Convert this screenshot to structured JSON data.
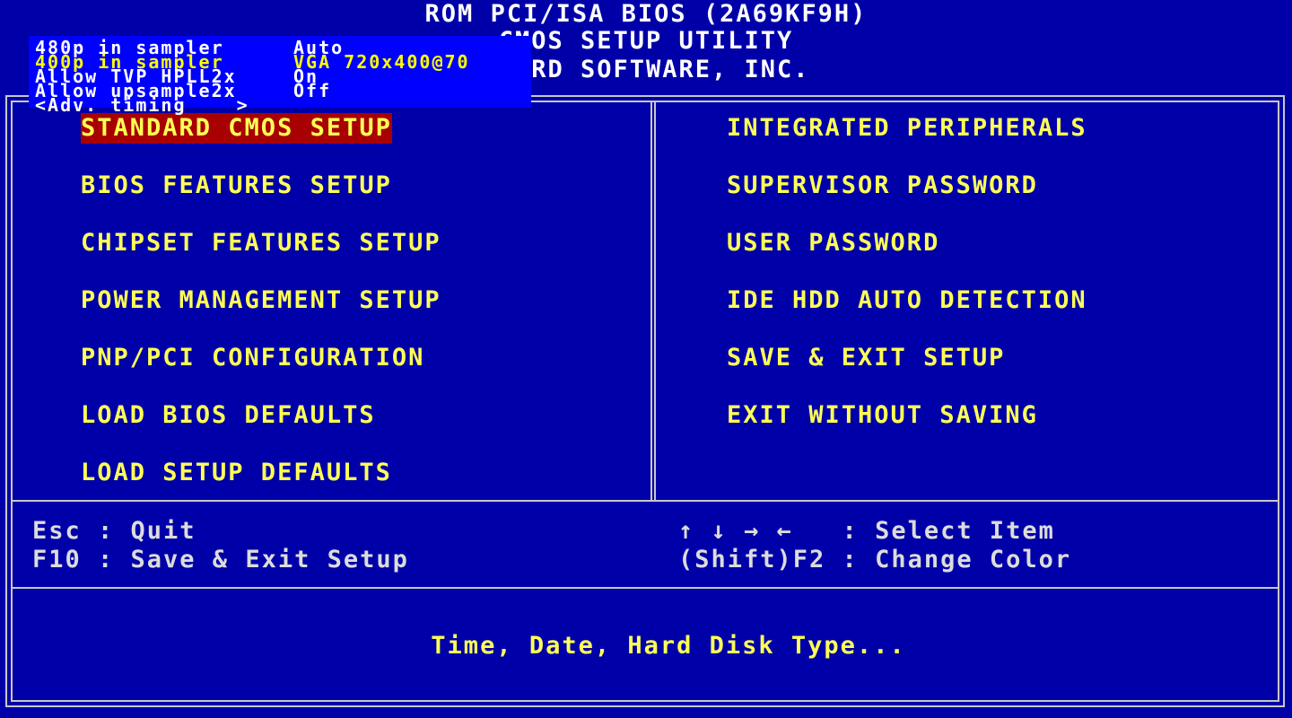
{
  "header": {
    "line1": "ROM PCI/ISA BIOS (2A69KF9H)",
    "line2": "CMOS SETUP UTILITY",
    "line3": "AWARD SOFTWARE, INC."
  },
  "menu_left": [
    {
      "label": "STANDARD CMOS SETUP",
      "selected": true
    },
    {
      "label": "BIOS FEATURES SETUP"
    },
    {
      "label": "CHIPSET FEATURES SETUP"
    },
    {
      "label": "POWER MANAGEMENT SETUP"
    },
    {
      "label": "PNP/PCI CONFIGURATION"
    },
    {
      "label": "LOAD BIOS DEFAULTS"
    },
    {
      "label": "LOAD SETUP DEFAULTS"
    }
  ],
  "menu_right": [
    {
      "label": "INTEGRATED PERIPHERALS"
    },
    {
      "label": "SUPERVISOR PASSWORD"
    },
    {
      "label": "USER PASSWORD"
    },
    {
      "label": "IDE HDD AUTO DETECTION"
    },
    {
      "label": "SAVE & EXIT SETUP"
    },
    {
      "label": "EXIT WITHOUT SAVING"
    }
  ],
  "keys": {
    "esc": "Esc : Quit",
    "f10": "F10 : Save & Exit Setup",
    "arrows": "↑ ↓ → ←   : Select Item",
    "shift_f2": "(Shift)F2 : Change Color"
  },
  "description": "Time, Date, Hard Disk Type...",
  "osd": {
    "rows": [
      {
        "label": "480p in sampler",
        "value": "Auto"
      },
      {
        "label": "400p in sampler",
        "value": "VGA 720x400@70",
        "highlight": true
      },
      {
        "label": "Allow TVP HPLL2x",
        "value": "On"
      },
      {
        "label": "Allow upsample2x",
        "value": "Off"
      },
      {
        "label": "<Adv. timing    >",
        "value": ""
      }
    ]
  },
  "colors": {
    "background": "#0000a8",
    "menu_text": "#ffff55",
    "selection": "#a80000",
    "osd_background": "#0000ff"
  }
}
